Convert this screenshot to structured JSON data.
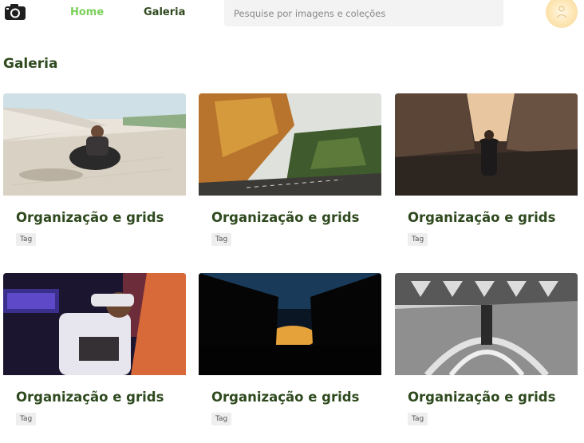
{
  "header": {
    "logo_icon": "camera-icon",
    "nav": {
      "home_label": "Home",
      "galeria_label": "Galeria"
    },
    "search": {
      "placeholder": "Pesquise por imagens e coleções",
      "value": ""
    },
    "avatar_icon": "user-avatar-icon"
  },
  "page": {
    "title": "Galeria"
  },
  "cards": [
    {
      "title": "Organização e grids",
      "tag": "Tag",
      "image": "man-crouching-on-stone-pavement"
    },
    {
      "title": "Organização e grids",
      "tag": "Tag",
      "image": "autumn-trees-road"
    },
    {
      "title": "Organização e grids",
      "tag": "Tag",
      "image": "woman-walking-cobblestone-street"
    },
    {
      "title": "Organização e grids",
      "tag": "Tag",
      "image": "person-wearing-vr-headset-neon"
    },
    {
      "title": "Organização e grids",
      "tag": "Tag",
      "image": "forest-silhouette-sunset"
    },
    {
      "title": "Organização e grids",
      "tag": "Tag",
      "image": "roller-coaster-under-dome"
    }
  ],
  "colors": {
    "nav_active": "#7bd05a",
    "heading": "#2f4a1f",
    "search_bg": "#f3f3f3",
    "tag_bg": "#eeeeee"
  }
}
